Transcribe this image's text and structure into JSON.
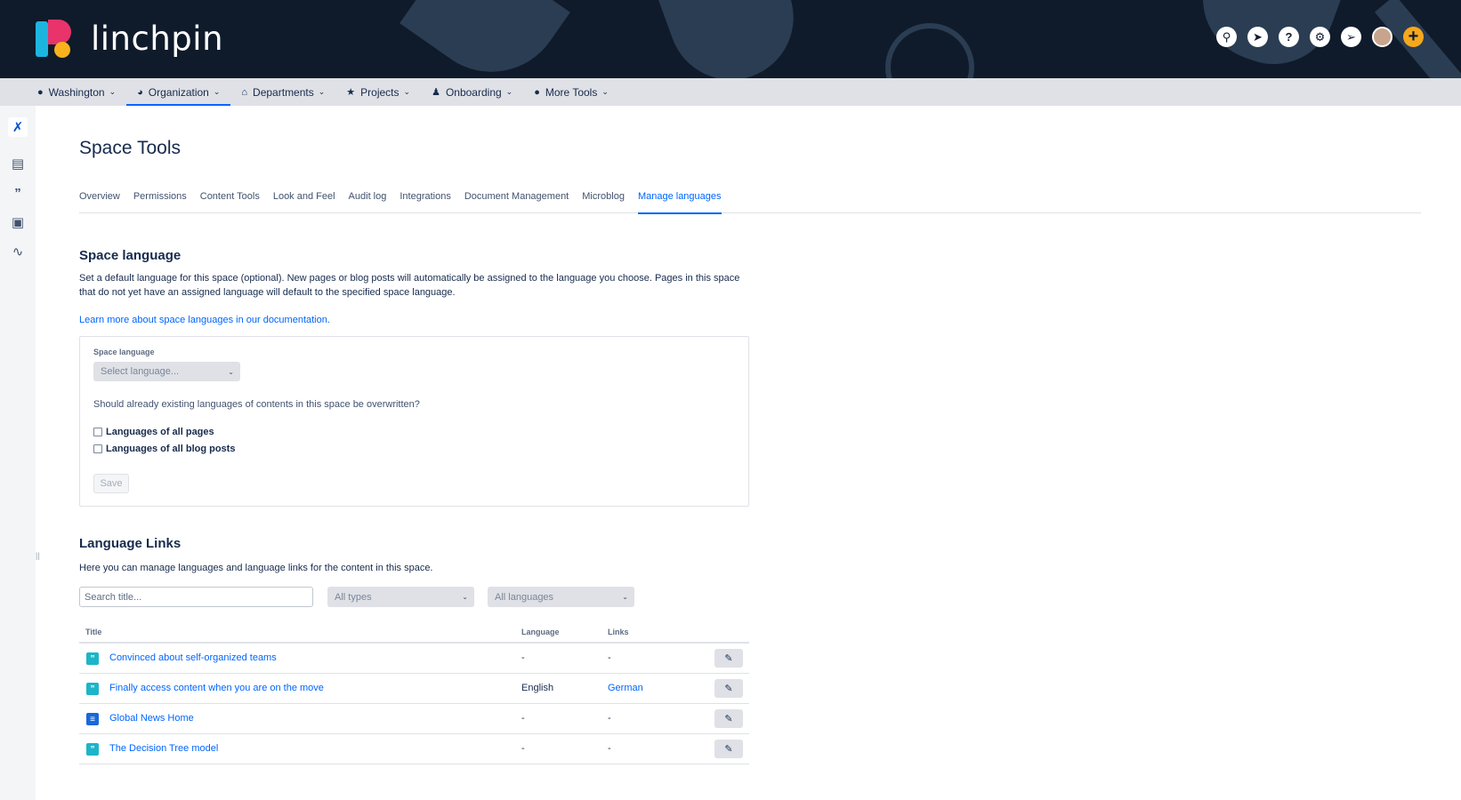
{
  "app": {
    "name": "linchpin"
  },
  "header": {
    "icons": [
      "search-icon",
      "compass-icon",
      "help-icon",
      "settings-icon",
      "rocket-icon",
      "avatar",
      "plus-icon"
    ]
  },
  "nav": {
    "items": [
      {
        "label": "Washington",
        "icon": "location-pin-icon"
      },
      {
        "label": "Organization",
        "icon": "globe-icon",
        "active": true
      },
      {
        "label": "Departments",
        "icon": "home-icon"
      },
      {
        "label": "Projects",
        "icon": "star-icon"
      },
      {
        "label": "Onboarding",
        "icon": "people-icon"
      },
      {
        "label": "More Tools",
        "icon": "lightbulb-icon"
      }
    ]
  },
  "sidebar": {
    "icons": [
      "confluence-icon",
      "page-icon",
      "quote-icon",
      "inbox-icon",
      "activity-icon"
    ]
  },
  "page": {
    "title": "Space Tools",
    "tabs": [
      "Overview",
      "Permissions",
      "Content Tools",
      "Look and Feel",
      "Audit log",
      "Integrations",
      "Document Management",
      "Microblog",
      "Manage languages"
    ],
    "active_tab": "Manage languages"
  },
  "space_language": {
    "title": "Space language",
    "description": "Set a default language for this space (optional). New pages or blog posts will automatically be assigned to the language you choose. Pages in this space that do not yet have an assigned language will default to the specified space language.",
    "doc_link": "Learn more about space languages in our documentation.",
    "field_label": "Space language",
    "select_placeholder": "Select language...",
    "question": "Should already existing languages of contents in this space be overwritten?",
    "checkbox_pages": "Languages of all pages",
    "checkbox_blogs": "Languages of all blog posts",
    "save_label": "Save"
  },
  "language_links": {
    "title": "Language Links",
    "description": "Here you can manage languages and language links for the content in this space.",
    "search_placeholder": "Search title...",
    "type_filter": "All types",
    "language_filter": "All languages",
    "columns": {
      "title": "Title",
      "language": "Language",
      "links": "Links"
    },
    "rows": [
      {
        "type": "blog",
        "title": "Convinced about self-organized teams",
        "language": "-",
        "links": "-"
      },
      {
        "type": "blog",
        "title": "Finally access content when you are on the move",
        "language": "English",
        "links": "German"
      },
      {
        "type": "page",
        "title": "Global News Home",
        "language": "-",
        "links": "-"
      },
      {
        "type": "blog",
        "title": "The Decision Tree model",
        "language": "-",
        "links": "-"
      }
    ]
  },
  "colors": {
    "header_bg": "#0f1b2b",
    "accent": "#0065ff",
    "plus_button": "#f6a81c",
    "logo_blue": "#1cb5e0",
    "logo_pink": "#e8336b",
    "logo_yellow": "#f9b21d"
  }
}
